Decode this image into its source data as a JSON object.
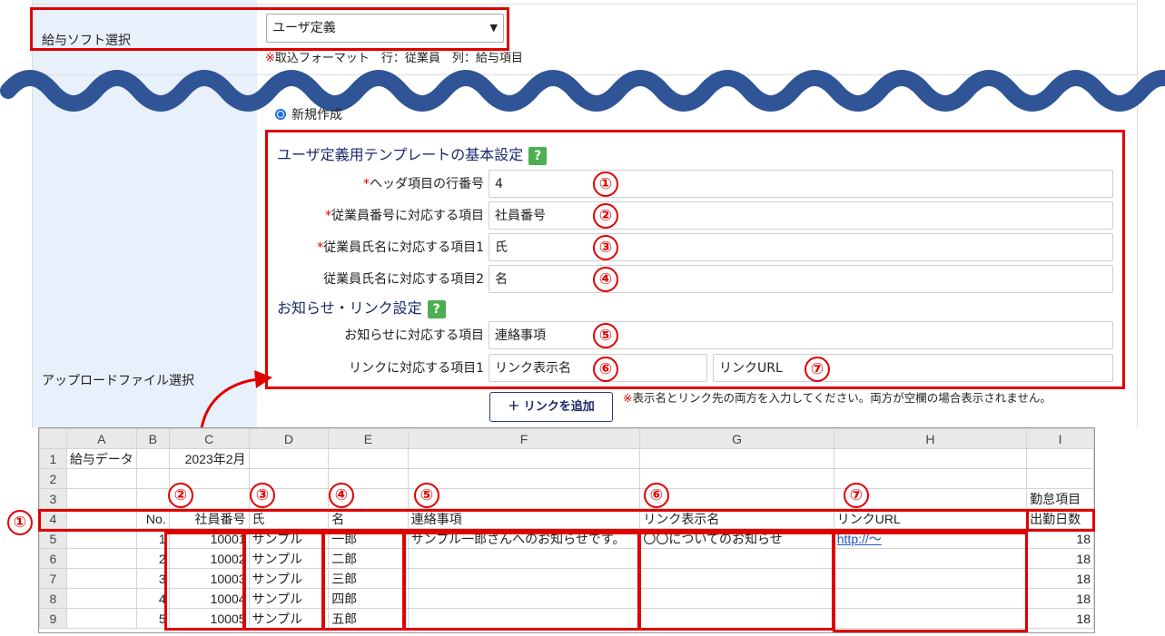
{
  "form": {
    "payroll_label": "給与ソフト選択",
    "payroll_select_value": "ユーザ定義",
    "payroll_note_mark": "※",
    "payroll_note": "取込フォーマット　行：従業員　列：給与項目",
    "radio_new_label": "新規作成",
    "upload_label": "アップロードファイル選択",
    "template_heading": "ユーザ定義用テンプレートの基本設定",
    "help_glyph": "?",
    "required_mark": "*",
    "fields": [
      {
        "label": "ヘッダ項目の行番号",
        "value": "4",
        "marker": "①"
      },
      {
        "label": "従業員番号に対応する項目",
        "value": "社員番号",
        "marker": "②"
      },
      {
        "label": "従業員氏名に対応する項目1",
        "value": "氏",
        "marker": "③"
      },
      {
        "label": "従業員氏名に対応する項目2",
        "value": "名",
        "marker": "④"
      }
    ],
    "notice_heading": "お知らせ・リンク設定",
    "notice_field": {
      "label": "お知らせに対応する項目",
      "value": "連絡事項",
      "marker": "⑤"
    },
    "link_field": {
      "label": "リンクに対応する項目1",
      "name_value": "リンク表示名",
      "name_marker": "⑥",
      "url_value": "リンクURL",
      "url_marker": "⑦"
    },
    "add_link_button": "＋ リンクを追加",
    "link_note_mark": "※",
    "link_note": "表示名とリンク先の両方を入力してください。両方が空欄の場合表示されません。"
  },
  "sheet": {
    "columns": [
      "A",
      "B",
      "C",
      "D",
      "E",
      "F",
      "G",
      "H",
      "I"
    ],
    "rows": [
      {
        "n": "1",
        "cells": [
          "給与データ",
          "",
          "2023年2月",
          "",
          "",
          "",
          "",
          "",
          ""
        ]
      },
      {
        "n": "2",
        "cells": [
          "",
          "",
          "",
          "",
          "",
          "",
          "",
          "",
          ""
        ]
      },
      {
        "n": "3",
        "cells": [
          "",
          "",
          "",
          "",
          "",
          "",
          "",
          "",
          "勤怠項目"
        ]
      },
      {
        "n": "4",
        "cells": [
          "",
          "No.",
          "社員番号",
          "氏",
          "名",
          "連絡事項",
          "リンク表示名",
          "リンクURL",
          "出勤日数"
        ]
      },
      {
        "n": "5",
        "cells": [
          "",
          "1",
          "10001",
          "サンプル",
          "一郎",
          "サンプル一郎さんへのお知らせです。",
          "〇〇についてのお知らせ",
          "http://～",
          "18"
        ]
      },
      {
        "n": "6",
        "cells": [
          "",
          "2",
          "10002",
          "サンプル",
          "二郎",
          "",
          "",
          "",
          "18"
        ]
      },
      {
        "n": "7",
        "cells": [
          "",
          "3",
          "10003",
          "サンプル",
          "三郎",
          "",
          "",
          "",
          "18"
        ]
      },
      {
        "n": "8",
        "cells": [
          "",
          "4",
          "10004",
          "サンプル",
          "四郎",
          "",
          "",
          "",
          "18"
        ]
      },
      {
        "n": "9",
        "cells": [
          "",
          "5",
          "10005",
          "サンプル",
          "五郎",
          "",
          "",
          "",
          "18"
        ]
      }
    ],
    "column_markers": [
      "②",
      "③",
      "④",
      "⑤",
      "⑥",
      "⑦"
    ],
    "row_marker": "①"
  },
  "colors": {
    "highlight": "#e00000",
    "wave": "#2f5597",
    "label_bg": "#e8f0fb",
    "help": "#4caf50",
    "heading": "#1a2a6c"
  }
}
